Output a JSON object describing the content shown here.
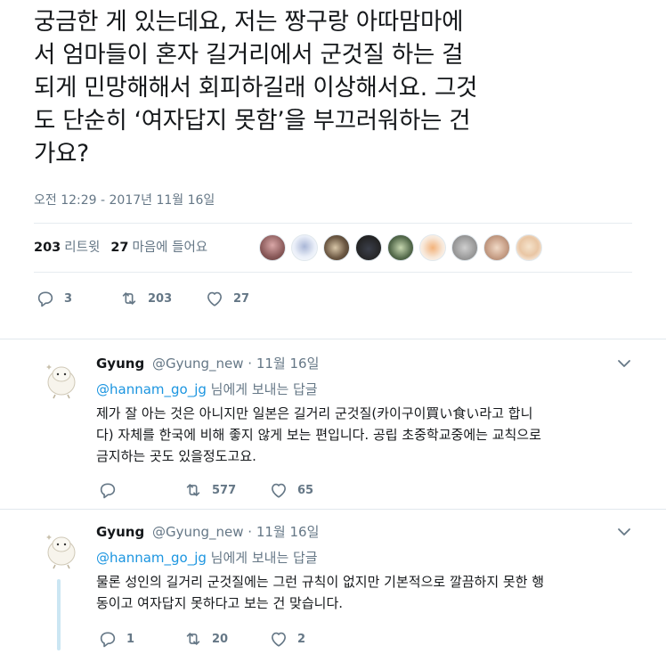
{
  "main_tweet": {
    "lines": [
      "궁금한 게 있는데요, 저는 짱구랑 아따맘마에",
      "서 엄마들이 혼자 길거리에서 군것질 하는 걸",
      "되게 민망해해서 회피하길래 이상해서요. 그것",
      "도 단순히 ‘여자답지 못함’을 부끄러워하는 건",
      "가요?"
    ],
    "timestamp": "오전 12:29 - 2017년 11월 16일",
    "retweet_count": "203",
    "retweet_label": "리트윗",
    "like_count": "27",
    "like_label": "마음에 들어요",
    "actions": {
      "replies": "3",
      "retweets": "203",
      "likes": "27"
    }
  },
  "replies": [
    {
      "name": "Gyung",
      "handle": "@Gyung_new",
      "date": "· 11월 16일",
      "mention": "@hannam_go_jg",
      "reply_suffix": " 님에게 보내는 답글",
      "lines": [
        "제가 잘 아는 것은 아니지만 일본은 길거리 군것질(카이구이買い食い라고 합니",
        "다) 자체를 한국에 비해 좋지 않게 보는 편입니다. 공립 초중학교중에는 교칙으로",
        "금지하는 곳도 있을정도고요."
      ],
      "actions": {
        "replies": "",
        "retweets": "577",
        "likes": "65"
      }
    },
    {
      "name": "Gyung",
      "handle": "@Gyung_new",
      "date": "· 11월 16일",
      "mention": "@hannam_go_jg",
      "reply_suffix": " 님에게 보내는 답글",
      "lines": [
        "물론 성인의 길거리 군것질에는 그런 규칙이 없지만 기본적으로 깔끔하지 못한 행",
        "동이고 여자답지 못하다고 보는 건 맞습니다."
      ],
      "actions": {
        "replies": "1",
        "retweets": "20",
        "likes": "2"
      }
    }
  ],
  "icons": [
    "reply-icon",
    "retweet-icon",
    "like-icon",
    "chevron-down-icon"
  ],
  "colors": {
    "link": "#1b95e0",
    "muted": "#657786",
    "divider": "#e6ecf0",
    "thread": "#cbe6f3"
  }
}
